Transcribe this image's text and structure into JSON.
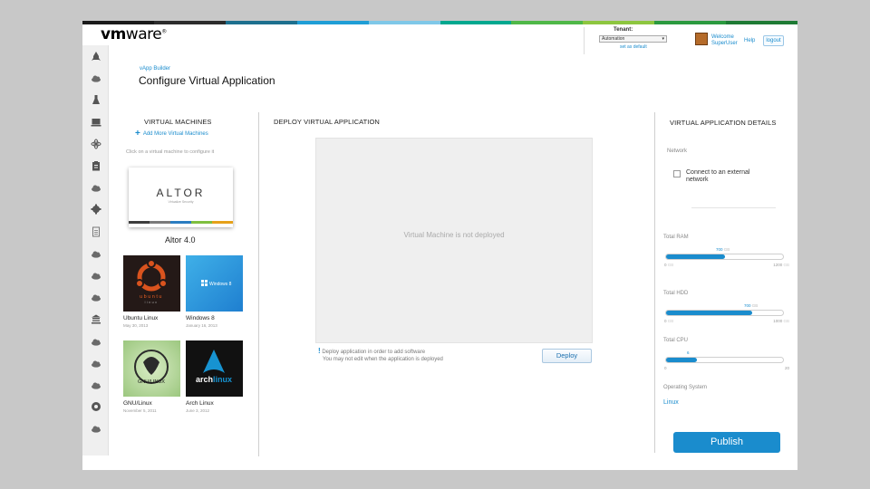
{
  "brand": {
    "logo_vm": "vm",
    "logo_ware": "ware",
    "registered": "®"
  },
  "topbar_colors": [
    "#1a1a1a",
    "#2c2c2c",
    "#1d6f8e",
    "#1f9ed6",
    "#7fc8e8",
    "#00a88f",
    "#4fb848",
    "#8dc63f",
    "#2b9a3f",
    "#1e7b34"
  ],
  "header": {
    "tenant_label": "Tenant:",
    "tenant_selected": "Automation",
    "set_default": "set as default",
    "welcome_line1": "Welcome",
    "welcome_line2": "SuperUser",
    "help": "Help",
    "logout": "logout"
  },
  "sidebar": {
    "icons": [
      "rocket-icon",
      "cloud-icon",
      "flask-icon",
      "monitor-icon",
      "atom-icon",
      "clipboard-icon",
      "cloud-icon",
      "gear-icon",
      "document-icon",
      "cloud-icon",
      "cloud-icon",
      "cloud-icon",
      "bank-icon",
      "cloud-icon",
      "cloud-icon",
      "cloud-icon",
      "disc-icon",
      "cloud-icon"
    ]
  },
  "page": {
    "breadcrumb": "vApp Builder",
    "title": "Configure Virtual Application"
  },
  "vm_panel": {
    "heading": "VIRTUAL MACHINES",
    "add_link": "Add More Virtual Machines",
    "hint": "Click on a virtual machine to configure it",
    "featured": {
      "logo": "ALTOR",
      "tagline": "Virtualize Security",
      "name": "Altor 4.0"
    },
    "machines": [
      {
        "name": "Ubuntu Linux",
        "date": "May 30, 2013",
        "logo_text": "ubuntu linux"
      },
      {
        "name": "Windows 8",
        "date": "January 16, 2013",
        "logo_text": "Windows 8"
      },
      {
        "name": "GNU/Linux",
        "date": "November 5, 2011",
        "logo_text": "GNU/LINUX"
      },
      {
        "name": "Arch Linux",
        "date": "June 3, 2012",
        "logo_text": "arch linux"
      }
    ]
  },
  "deploy_panel": {
    "heading": "DEPLOY VIRTUAL APPLICATION",
    "placeholder": "Virtual Machine is not deployed",
    "note_line1": "Deploy application in order to add software",
    "note_line2": "You may not edit when the application is deployed",
    "deploy_button": "Deploy"
  },
  "details_panel": {
    "heading": "VIRTUAL APPLICATION DETAILS",
    "network_label": "Network",
    "network_checkbox_label": "Connect to an external network",
    "network_checked": false,
    "resources": [
      {
        "label": "Total RAM",
        "value": "700",
        "unit": "GB",
        "min": "0",
        "max": "1200",
        "fraction": 0.5
      },
      {
        "label": "Total HDD",
        "value": "700",
        "unit": "GB",
        "min": "0",
        "max": "1000",
        "fraction": 0.74
      },
      {
        "label": "Total CPU",
        "value": "6",
        "unit": "",
        "min": "0",
        "max": "20",
        "fraction": 0.26
      }
    ],
    "os_label": "Operating System",
    "os_value": "Linux",
    "publish_button": "Publish"
  },
  "colors": {
    "accent": "#1a8ccd",
    "sidebar_bg": "#efefef",
    "deploy_area_bg": "#efefef"
  }
}
